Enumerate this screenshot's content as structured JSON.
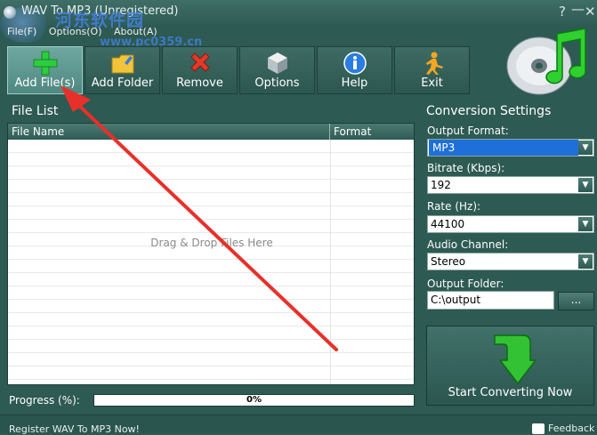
{
  "window": {
    "title": "WAV To MP3 (Unregistered)",
    "help_btn": "?",
    "minimize_btn": "—",
    "close_btn": "✕"
  },
  "watermark": {
    "text": "河东软件园",
    "url": "www.pc0359.cn"
  },
  "menu": [
    "File(F)",
    "Options(O)",
    "About(A)"
  ],
  "toolbar": [
    {
      "label": "Add File(s)",
      "icon": "plus-icon",
      "active": true
    },
    {
      "label": "Add Folder",
      "icon": "folder-icon"
    },
    {
      "label": "Remove",
      "icon": "remove-x-icon"
    },
    {
      "label": "Options",
      "icon": "cube-icon"
    },
    {
      "label": "Help",
      "icon": "info-icon"
    },
    {
      "label": "Exit",
      "icon": "runner-icon"
    }
  ],
  "file_list": {
    "title": "File List",
    "columns": [
      "File Name",
      "Format"
    ],
    "empty_hint": "Drag & Drop Files Here"
  },
  "progress": {
    "label": "Progress (%):",
    "value_text": "0%",
    "value": 0
  },
  "settings": {
    "title": "Conversion Settings",
    "output_format": {
      "label": "Output Format:",
      "value": "MP3"
    },
    "bitrate": {
      "label": "Bitrate (Kbps):",
      "value": "192"
    },
    "rate": {
      "label": "Rate (Hz):",
      "value": "44100"
    },
    "channel": {
      "label": "Audio Channel:",
      "value": "Stereo"
    },
    "folder": {
      "label": "Output Folder:",
      "value": "C:\\output",
      "browse": "..."
    }
  },
  "start_button": "Start Converting Now",
  "status": {
    "register": "Register WAV To MP3 Now!",
    "feedback": "Feedback"
  },
  "colors": {
    "background": "#2d5a52",
    "arrow": "#e8302a",
    "accent_select": "#1e6fd8"
  }
}
